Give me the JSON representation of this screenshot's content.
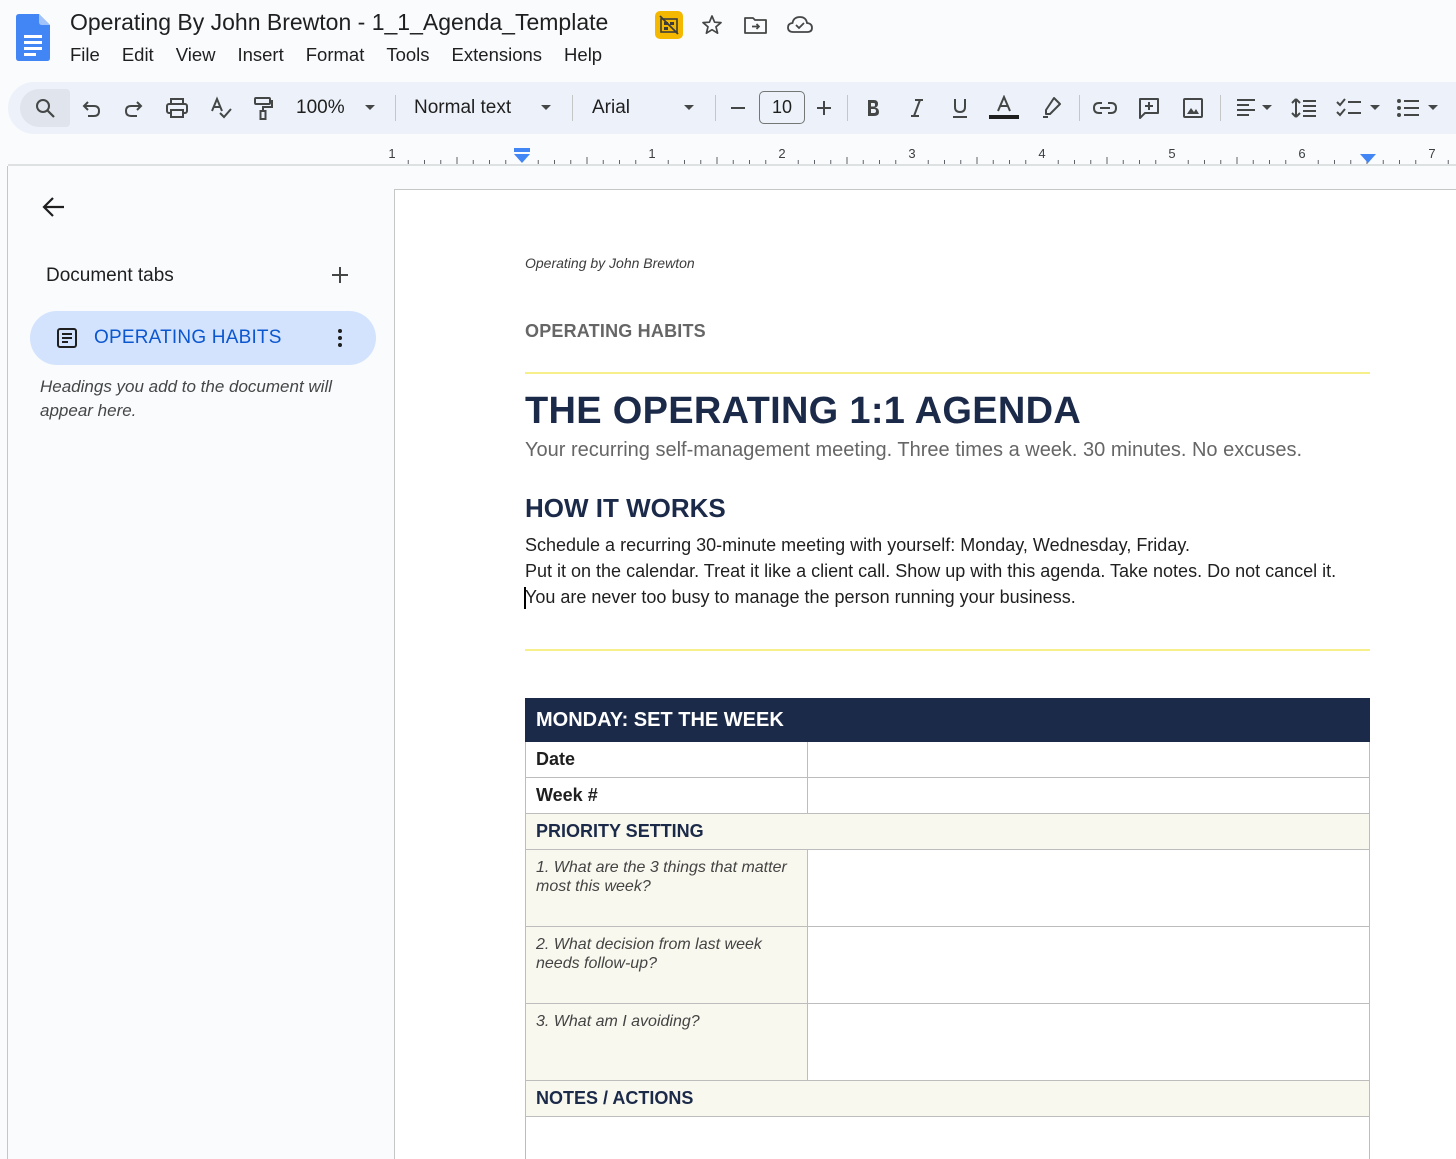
{
  "app": {
    "doc_title": "Operating By John Brewton - 1_1_Agenda_Template",
    "title_icons": [
      "no-sharing-badge-icon",
      "star-icon",
      "move-to-folder-icon",
      "cloud-saved-icon"
    ],
    "menu": [
      "File",
      "Edit",
      "View",
      "Insert",
      "Format",
      "Tools",
      "Extensions",
      "Help"
    ]
  },
  "toolbar": {
    "zoom": "100%",
    "style": "Normal text",
    "font": "Arial",
    "font_size": "10"
  },
  "ruler": {
    "numbers": [
      "1",
      "1",
      "2",
      "3",
      "4",
      "5",
      "6",
      "7"
    ]
  },
  "sidebar": {
    "title": "Document tabs",
    "active_tab": "OPERATING HABITS",
    "hint": "Headings you add to the document will appear here."
  },
  "document": {
    "header": "Operating by John Brewton",
    "section_label": "OPERATING HABITS",
    "title": "THE OPERATING 1:1 AGENDA",
    "subtitle": "Your recurring self-management meeting. Three times a week. 30 minutes. No excuses.",
    "h2": "HOW IT WORKS",
    "body": [
      "Schedule a recurring 30-minute meeting with yourself: Monday, Wednesday, Friday.",
      "Put it on the calendar. Treat it like a client call. Show up with this agenda. Take notes. Do not cancel it.",
      "You are never too busy to manage the person running your business."
    ],
    "table": {
      "heading": "MONDAY: SET THE WEEK",
      "rows": [
        "Date",
        "Week #"
      ],
      "section1": "PRIORITY SETTING",
      "questions": [
        "1. What are the 3 things that matter most this week?",
        "2. What decision from last week needs follow-up?",
        "3. What am I avoiding?"
      ],
      "section2": "NOTES / ACTIONS"
    }
  },
  "colors": {
    "navy": "#1c2a4a",
    "accent_blue": "#0b57d0",
    "tab_bg": "#d3e3fd",
    "divider_yellow": "#f7ef8a",
    "section_bg": "#f8f8ee"
  }
}
